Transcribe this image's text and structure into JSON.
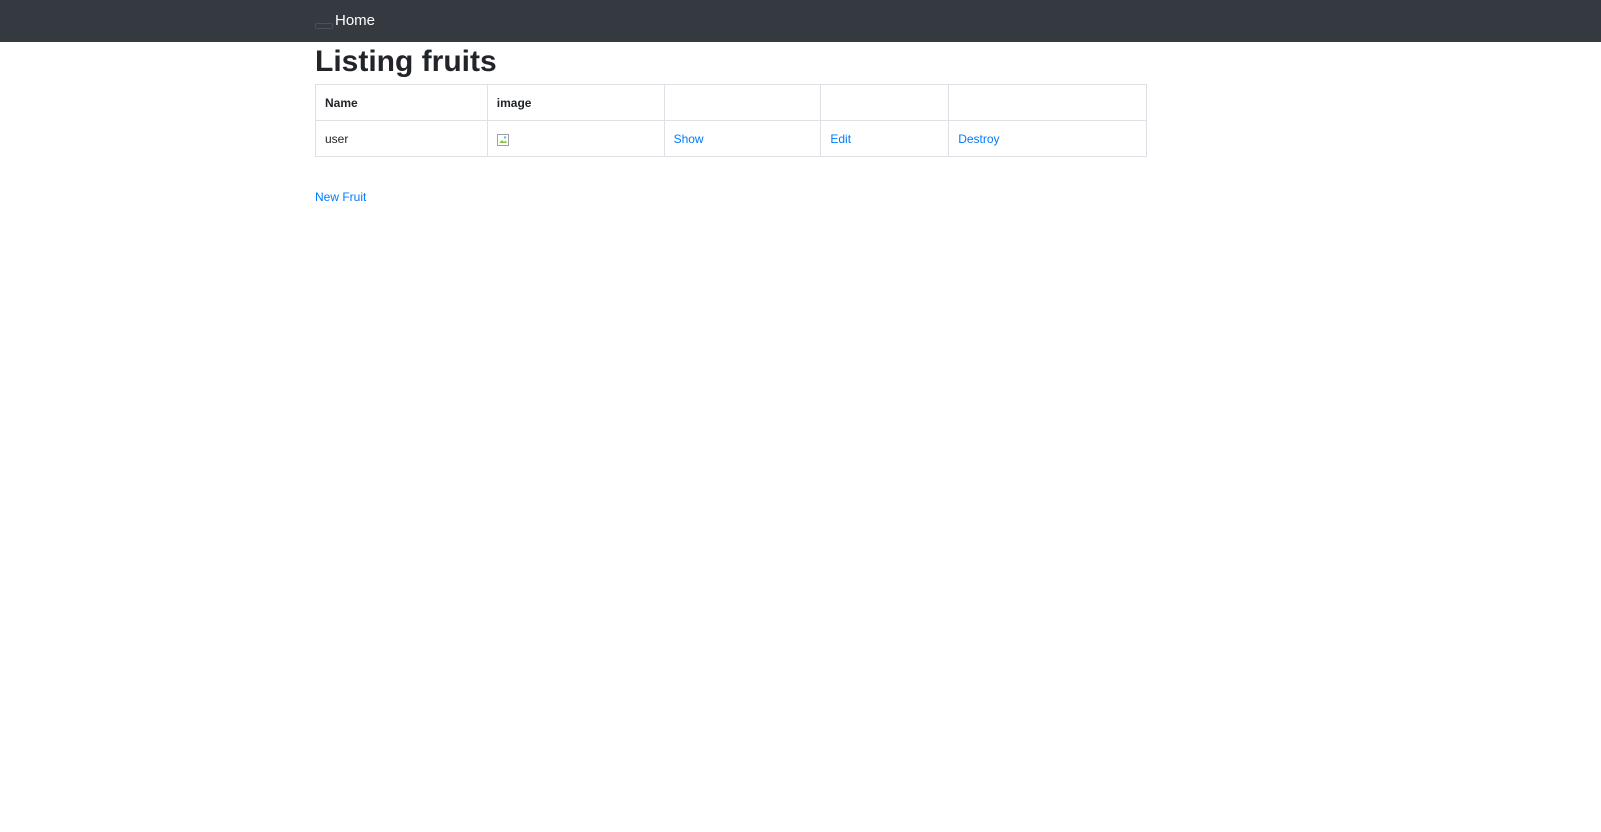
{
  "navbar": {
    "brand": "Home",
    "toggler_icon": "hamburger-icon"
  },
  "page": {
    "title": "Listing fruits"
  },
  "table": {
    "headers": [
      "Name",
      "image",
      "",
      "",
      ""
    ],
    "rows": [
      {
        "name": "user",
        "image_icon": "broken-image-icon",
        "show": "Show",
        "edit": "Edit",
        "destroy": "Destroy"
      }
    ]
  },
  "actions": {
    "new_fruit": "New Fruit"
  },
  "colors": {
    "navbar_bg": "#343a40",
    "link": "#007bff",
    "border": "#dee2e6"
  }
}
